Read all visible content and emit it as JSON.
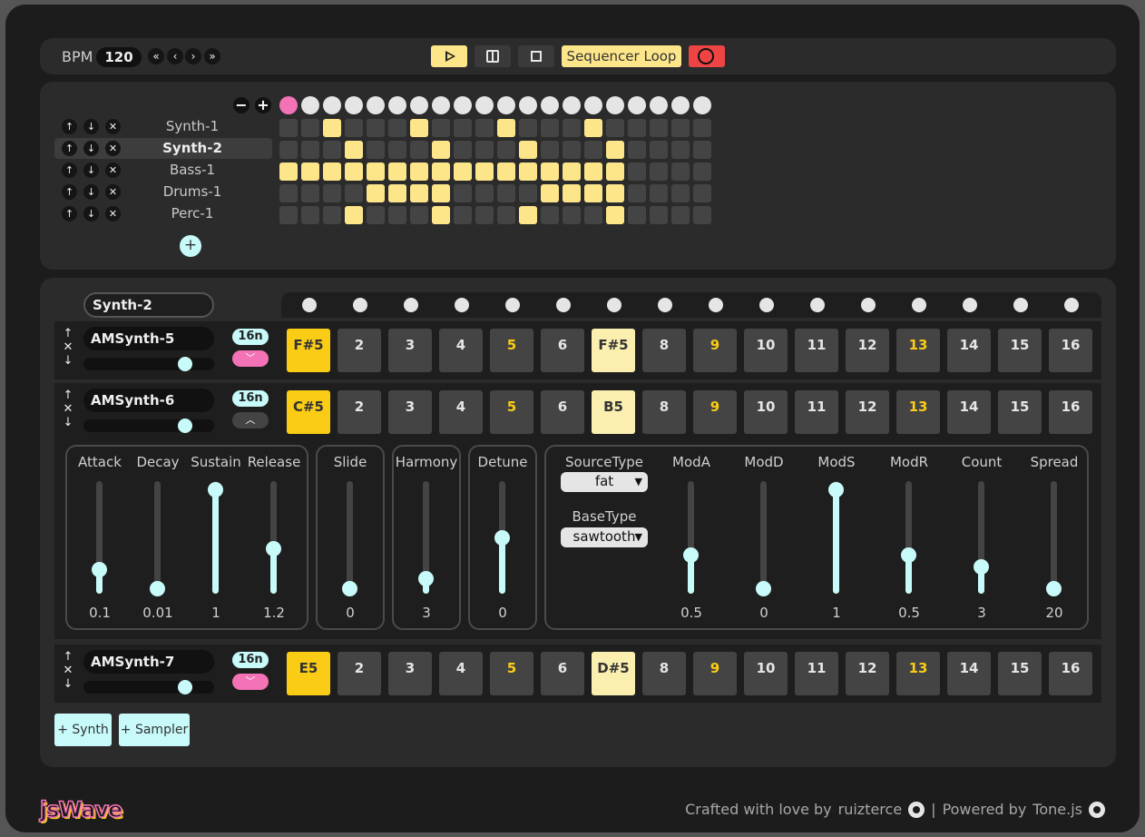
{
  "transport": {
    "bpm_label": "BPM",
    "bpm_value": "120",
    "nav": [
      "«",
      "‹",
      "›",
      "»"
    ],
    "loop_label": "Sequencer Loop"
  },
  "overview": {
    "minus": "−",
    "plus": "+",
    "add": "+",
    "active_step": 1,
    "tracks": [
      {
        "name": "Synth-1",
        "selected": false,
        "steps": [
          0,
          0,
          1,
          0,
          0,
          0,
          1,
          0,
          0,
          0,
          1,
          0,
          0,
          0,
          1,
          0,
          0,
          0,
          0,
          0
        ]
      },
      {
        "name": "Synth-2",
        "selected": true,
        "steps": [
          0,
          0,
          0,
          1,
          0,
          0,
          0,
          1,
          0,
          0,
          0,
          1,
          0,
          0,
          0,
          1,
          0,
          0,
          0,
          0
        ]
      },
      {
        "name": "Bass-1",
        "selected": false,
        "steps": [
          1,
          1,
          1,
          1,
          1,
          1,
          1,
          1,
          1,
          1,
          1,
          1,
          1,
          1,
          1,
          1,
          0,
          0,
          0,
          0
        ]
      },
      {
        "name": "Drums-1",
        "selected": false,
        "steps": [
          0,
          0,
          0,
          0,
          1,
          1,
          1,
          1,
          0,
          0,
          0,
          0,
          1,
          1,
          1,
          1,
          0,
          0,
          0,
          0
        ]
      },
      {
        "name": "Perc-1",
        "selected": false,
        "steps": [
          0,
          0,
          0,
          1,
          0,
          0,
          0,
          1,
          0,
          0,
          0,
          1,
          0,
          0,
          0,
          1,
          0,
          0,
          0,
          0
        ]
      }
    ],
    "row_buttons": [
      "↑",
      "↓",
      "✕"
    ]
  },
  "editor": {
    "sequence_name": "Synth-2",
    "rows": [
      {
        "name": "AMSynth-5",
        "length": "16n",
        "volume": 0.78,
        "expanded": false,
        "steps": [
          "F#5",
          "2",
          "3",
          "4",
          "5",
          "6",
          "F#5",
          "8",
          "9",
          "10",
          "11",
          "12",
          "13",
          "14",
          "15",
          "16"
        ]
      },
      {
        "name": "AMSynth-6",
        "length": "16n",
        "volume": 0.78,
        "expanded": true,
        "steps": [
          "C#5",
          "2",
          "3",
          "4",
          "5",
          "6",
          "B5",
          "8",
          "9",
          "10",
          "11",
          "12",
          "13",
          "14",
          "15",
          "16"
        ]
      },
      {
        "name": "AMSynth-7",
        "length": "16n",
        "volume": 0.78,
        "expanded": false,
        "steps": [
          "E5",
          "2",
          "3",
          "4",
          "5",
          "6",
          "D#5",
          "8",
          "9",
          "10",
          "11",
          "12",
          "13",
          "14",
          "15",
          "16"
        ]
      }
    ],
    "arrow_symbols": [
      "↑",
      "✕",
      "↓"
    ],
    "envelope": [
      {
        "label": "Attack",
        "value": "0.1",
        "level": 0.22
      },
      {
        "label": "Decay",
        "value": "0.01",
        "level": 0.05
      },
      {
        "label": "Sustain",
        "value": "1",
        "level": 0.93
      },
      {
        "label": "Release",
        "value": "1.2",
        "level": 0.4
      }
    ],
    "slide": {
      "label": "Slide",
      "value": "0",
      "level": 0.05
    },
    "harmony": {
      "label": "Harmony",
      "value": "3",
      "level": 0.14
    },
    "detune": {
      "label": "Detune",
      "value": "0",
      "level": 0.5
    },
    "oscillator": {
      "source_type_label": "SourceType",
      "source_type_value": "fat",
      "base_type_label": "BaseType",
      "base_type_value": "sawtooth"
    },
    "modulation": [
      {
        "label": "ModA",
        "value": "0.5",
        "level": 0.35
      },
      {
        "label": "ModD",
        "value": "0",
        "level": 0.05
      },
      {
        "label": "ModS",
        "value": "1",
        "level": 0.93
      },
      {
        "label": "ModR",
        "value": "0.5",
        "level": 0.35
      },
      {
        "label": "Count",
        "value": "3",
        "level": 0.24
      },
      {
        "label": "Spread",
        "value": "20",
        "level": 0.05
      }
    ],
    "add_synth": "+ Synth",
    "add_sampler": "+ Sampler"
  },
  "footer": {
    "logo": "jsWave",
    "crafted": "Crafted with love by",
    "author": "ruizterce",
    "separator": "|",
    "powered": "Powered by",
    "lib": "Tone.js"
  },
  "colors": {
    "accent": "#fde68a",
    "note": "#facc15",
    "pink": "#f472b6",
    "cyan": "#c8fafa",
    "record": "#ef4444"
  }
}
